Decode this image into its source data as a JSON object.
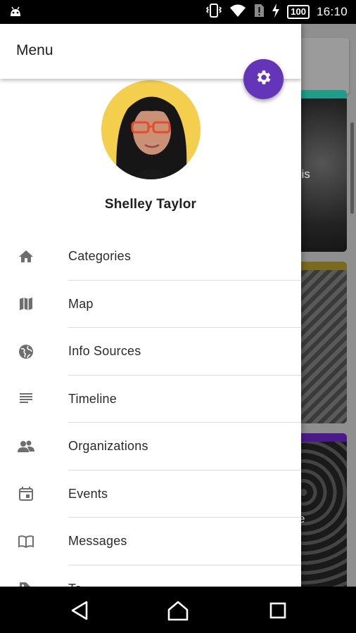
{
  "status_bar": {
    "time": "16:10",
    "battery": "100",
    "icons": [
      "android-icon",
      "vibrate-icon",
      "wifi-icon",
      "no-sim-icon",
      "charging-icon"
    ]
  },
  "background": {
    "visible_text_fragments": [
      "sis",
      "e"
    ]
  },
  "drawer": {
    "title": "Menu",
    "settings_icon": "gear-icon",
    "user_name": "Shelley Taylor",
    "items": [
      {
        "label": "Categories",
        "icon": "home-icon"
      },
      {
        "label": "Map",
        "icon": "map-icon"
      },
      {
        "label": "Info Sources",
        "icon": "globe-icon"
      },
      {
        "label": "Timeline",
        "icon": "notes-icon"
      },
      {
        "label": "Organizations",
        "icon": "people-icon"
      },
      {
        "label": "Events",
        "icon": "calendar-icon"
      },
      {
        "label": "Messages",
        "icon": "book-icon"
      },
      {
        "label": "Ta",
        "icon": "tag-icon"
      }
    ]
  },
  "colors": {
    "accent": "#6435b8",
    "card_stripe_1": "#1f9d8a",
    "card_stripe_2": "#7a6a1e",
    "card_stripe_3": "#4a1a8c",
    "avatar_background": "#f3cf4d"
  },
  "nav_bar": {
    "buttons": [
      "back-icon",
      "home-icon",
      "recents-icon"
    ]
  }
}
